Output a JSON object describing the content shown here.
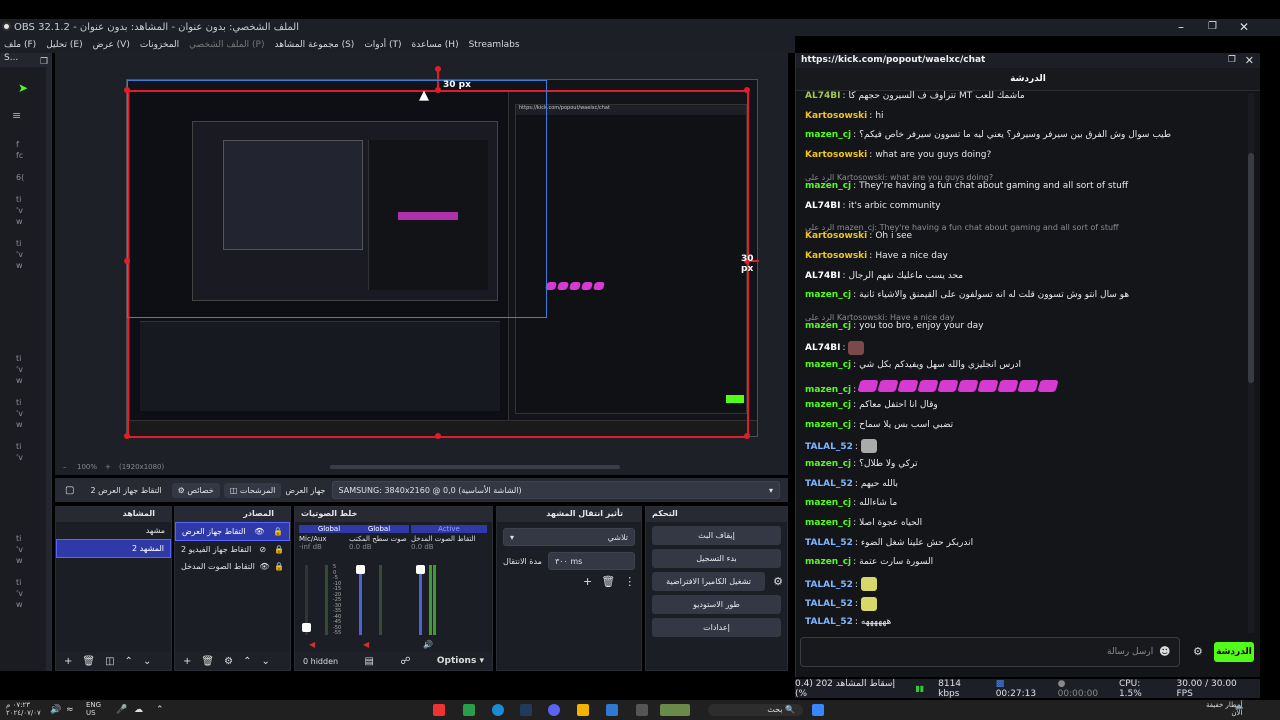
{
  "window": {
    "title": "OBS 32.1.2 - الملف الشخصي: بدون عنوان - المشاهد: بدون عنوان"
  },
  "menu": [
    "ملف (F)",
    "تحليل (E)",
    "عرض (V)",
    "المخزونات",
    "الملف الشخصي (P)",
    "مجموعة المشاهد (S)",
    "أدوات (T)",
    "مساعدة (H)",
    "Streamlabs"
  ],
  "preview": {
    "marker_top": "30 px",
    "marker_right": "30 px",
    "zoom": "100%",
    "canvas_size": "(1920x1080)"
  },
  "scenebar": {
    "display_label": "التقاط جهاز العرض 2",
    "properties": "خصائص",
    "filters": "المرشحات",
    "device_label": "جهاز العرض",
    "device_value": "SAMSUNG: 3840x2160 @ 0,0 (الشاشة الأساسية)"
  },
  "scenes": {
    "title": "المشاهد",
    "items": [
      "مشهد",
      "المشهد 2"
    ]
  },
  "sources": {
    "title": "المصادر",
    "items": [
      "التقاط جهاز العرض",
      "التقاط جهاز الفيديو 2",
      "التقاط الصوت المدخل"
    ]
  },
  "mixer": {
    "title": "خلط الصوتيات",
    "channels": [
      {
        "tag": "Global",
        "name": "Mic/Aux",
        "db": "-inf dB"
      },
      {
        "tag": "Global",
        "name": "صوت سطح المكتب",
        "db": "0.0 dB"
      },
      {
        "tag": "Active",
        "name": "التقاط الصوت المدخل",
        "db": "0.0 dB"
      }
    ],
    "hidden": "0 hidden",
    "options": "Options",
    "scale": [
      "5",
      "0",
      "-5",
      "-10",
      "-15",
      "-20",
      "-25",
      "-30",
      "-35",
      "-40",
      "-45",
      "-50",
      "-55"
    ]
  },
  "transitions": {
    "title": "تأثير انتقال المشهد",
    "type": "تلاشي",
    "duration_label": "مدة الانتقال",
    "duration": "٣٠٠ ms"
  },
  "controls": {
    "title": "التحكم",
    "buttons": [
      "إيقاف البث",
      "بدء التسجيل",
      "تشغيل الكاميرا الافتراضية",
      "طور الاستوديو",
      "إعدادات"
    ]
  },
  "chat": {
    "url": "https://kick.com/popout/waelxc/chat",
    "header": "الدردشة",
    "messages": [
      {
        "type": "msg",
        "user": "AL74BI",
        "color": "#a3c94a",
        "text": "تتراوف ف السيرون حجهم  كا MT ماشمك للعب"
      },
      {
        "type": "msg",
        "user": "Kartosowski",
        "color": "#f0c419",
        "text": "hi"
      },
      {
        "type": "msg",
        "user": "mazen_cj",
        "color": "#53fc18",
        "text": "طيب سوال وش الفرق بين سيرفر وسيرفر؟ يعني ليه ما تسوون سيرفر خاص فيكم؟"
      },
      {
        "type": "msg",
        "user": "Kartosowski",
        "color": "#f0c419",
        "text": "what are you guys doing?"
      },
      {
        "type": "reply",
        "text": "الرد على Kartosowski: what are you guys doing?"
      },
      {
        "type": "msg",
        "user": "mazen_cj",
        "color": "#53fc18",
        "text": "They're having a fun chat about gaming and all sort of stuff"
      },
      {
        "type": "msg",
        "user": "AL74BI",
        "color": "#ffffff",
        "text": "it's arbic community"
      },
      {
        "type": "reply",
        "text": "الرد على mazen_cj: They're having a fun chat about gaming and all sort of stuff"
      },
      {
        "type": "msg",
        "user": "Kartosowski",
        "color": "#f0c419",
        "text": "Oh i see"
      },
      {
        "type": "msg",
        "user": "Kartosowski",
        "color": "#f0c419",
        "text": "Have a nice day"
      },
      {
        "type": "msg",
        "user": "AL74BI",
        "color": "#ffffff",
        "text": "محد يسب ماعليك نفهم الرجال"
      },
      {
        "type": "msg",
        "user": "mazen_cj",
        "color": "#53fc18",
        "text": "هو سال انتو وش تسوون قلت له انه تسولفون على القيمنق والاشياء ثانية"
      },
      {
        "type": "reply",
        "text": "الرد على Kartosowski: Have a nice day"
      },
      {
        "type": "msg",
        "user": "mazen_cj",
        "color": "#53fc18",
        "text": "you too bro, enjoy your day"
      },
      {
        "type": "msg",
        "user": "AL74BI",
        "color": "#ffffff",
        "text": ""
      },
      {
        "type": "msg",
        "user": "mazen_cj",
        "color": "#53fc18",
        "text": "ادرس انجليزي والله سهل ويفيدكم بكل شي"
      },
      {
        "type": "msg",
        "user": "mazen_cj",
        "color": "#53fc18",
        "text": ""
      },
      {
        "type": "msg",
        "user": "mazen_cj",
        "color": "#53fc18",
        "text": "وقال انا احتفل معاكم"
      },
      {
        "type": "msg",
        "user": "mazen_cj",
        "color": "#53fc18",
        "text": "تضبي اسب بس يلا سماح"
      },
      {
        "type": "msg",
        "user": "TALAL_52",
        "color": "#7fb6ff",
        "text": ""
      },
      {
        "type": "msg",
        "user": "mazen_cj",
        "color": "#53fc18",
        "text": "تركي ولا طلال؟"
      },
      {
        "type": "msg",
        "user": "TALAL_52",
        "color": "#7fb6ff",
        "text": "بالله حيهم"
      },
      {
        "type": "msg",
        "user": "mazen_cj",
        "color": "#53fc18",
        "text": "ما شاءالله"
      },
      {
        "type": "msg",
        "user": "mazen_cj",
        "color": "#53fc18",
        "text": "الحياه عجوة اصلا"
      },
      {
        "type": "msg",
        "user": "TALAL_52",
        "color": "#7fb6ff",
        "text": "اندربكر حش علينا شغل الضوء"
      },
      {
        "type": "msg",
        "user": "mazen_cj",
        "color": "#53fc18",
        "text": "السورة سارت عتمة"
      },
      {
        "type": "msg",
        "user": "TALAL_52",
        "color": "#7fb6ff",
        "text": ""
      },
      {
        "type": "msg",
        "user": "TALAL_52",
        "color": "#7fb6ff",
        "text": ""
      },
      {
        "type": "msg",
        "user": "TALAL_52",
        "color": "#7fb6ff",
        "text": "ههههههه"
      }
    ],
    "input_placeholder": "ارسل رسالة",
    "send": "الدردشة"
  },
  "status": {
    "dropped": "إسقاط المشاهد 202 (0.4 %)",
    "bitrate": "8114 kbps",
    "stream_time": "00:27:13",
    "rec_time": "00:00:00",
    "cpu": "CPU: 1.5%",
    "fps": "30.00 / 30.00 FPS"
  },
  "taskbar": {
    "time": "٠٧:٢٣ م",
    "date": "٢٠٢٤/٠٧/٠٧",
    "lang": "ENG",
    "region": "US",
    "search": "بحث",
    "weather": "أمطار خفيفة",
    "weather_sub": "الآن"
  },
  "colors": {
    "accent": "#53fc18",
    "selection": "#2f3aa8",
    "redbox": "#e11d2b"
  }
}
